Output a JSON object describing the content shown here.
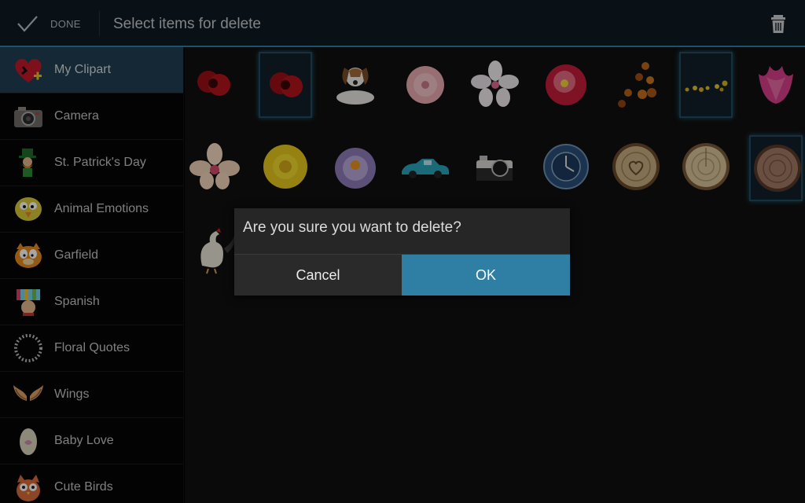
{
  "actionbar": {
    "done_label": "DONE",
    "title": "Select items for delete",
    "done_icon": "check-icon",
    "trash_icon": "trash-icon",
    "accent": "#2c7ea6"
  },
  "sidebar": {
    "items": [
      {
        "label": "My Clipart",
        "icon": "heart-icon",
        "active": true
      },
      {
        "label": "Camera",
        "icon": "camera-icon"
      },
      {
        "label": "St. Patrick's Day",
        "icon": "leprechaun-icon"
      },
      {
        "label": "Animal Emotions",
        "icon": "bird-face-icon"
      },
      {
        "label": "Garfield",
        "icon": "garfield-icon"
      },
      {
        "label": "Spanish",
        "icon": "spanish-icon"
      },
      {
        "label": "Floral Quotes",
        "icon": "ring-icon"
      },
      {
        "label": "Wings",
        "icon": "wings-icon"
      },
      {
        "label": "Baby Love",
        "icon": "egg-icon"
      },
      {
        "label": "Cute Birds",
        "icon": "owl-icon"
      }
    ]
  },
  "grid": {
    "items": [
      {
        "name": "red-rose",
        "selected": false
      },
      {
        "name": "red-rose",
        "selected": true
      },
      {
        "name": "beagle-dog",
        "selected": false
      },
      {
        "name": "pink-flower",
        "selected": false
      },
      {
        "name": "white-blossom",
        "selected": false
      },
      {
        "name": "red-peony",
        "selected": false
      },
      {
        "name": "bokeh-lights",
        "selected": false
      },
      {
        "name": "sparkle-dots",
        "selected": true
      },
      {
        "name": "pink-tulip",
        "selected": false
      },
      {
        "name": "orchid",
        "selected": false
      },
      {
        "name": "yellow-daffodil",
        "selected": false
      },
      {
        "name": "purple-crocus",
        "selected": false
      },
      {
        "name": "blue-car",
        "selected": false
      },
      {
        "name": "vintage-camera",
        "selected": false
      },
      {
        "name": "blue-clock",
        "selected": false
      },
      {
        "name": "wood-slice-heart",
        "selected": false
      },
      {
        "name": "wood-slice",
        "selected": false
      },
      {
        "name": "wood-slice-dark",
        "selected": true
      },
      {
        "name": "rooster",
        "selected": false
      }
    ]
  },
  "dialog": {
    "message": "Are you sure you want to delete?",
    "cancel_label": "Cancel",
    "ok_label": "OK",
    "ok_color": "#2f7ea3"
  }
}
